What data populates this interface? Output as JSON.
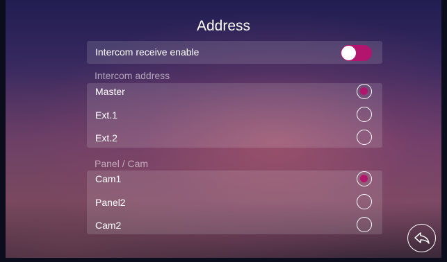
{
  "page": {
    "title": "Address"
  },
  "intercom_receive": {
    "label": "Intercom receive enable",
    "enabled": true
  },
  "intercom_address": {
    "heading": "Intercom address",
    "options": [
      {
        "label": "Master",
        "selected": true
      },
      {
        "label": "Ext.1",
        "selected": false
      },
      {
        "label": "Ext.2",
        "selected": false
      }
    ]
  },
  "panel_cam": {
    "heading": "Panel / Cam",
    "options": [
      {
        "label": "Cam1",
        "selected": true
      },
      {
        "label": "Panel2",
        "selected": false
      },
      {
        "label": "Cam2",
        "selected": false
      }
    ]
  },
  "colors": {
    "accent": "#b2146e",
    "background_top": "#211e52",
    "background_bottom": "#7a4a62"
  },
  "icons": {
    "back": "back-arrow-icon"
  }
}
